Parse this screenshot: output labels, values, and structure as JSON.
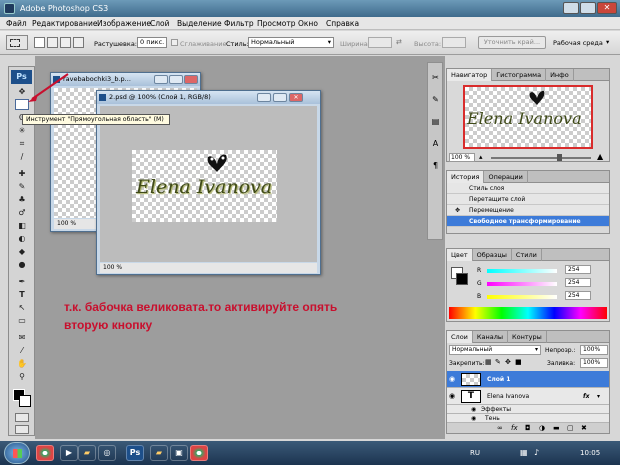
{
  "app": {
    "title": "Adobe Photoshop CS3",
    "ps_logo": "Ps"
  },
  "menu": [
    "Файл",
    "Редактирование",
    "Изображение",
    "Слой",
    "Выделение",
    "Фильтр",
    "Просмотр",
    "Окно",
    "Справка"
  ],
  "options": {
    "feather_label": "Растушевка:",
    "feather_value": "0 пикс.",
    "antialias_label": "Сглаживание",
    "style_label": "Стиль:",
    "style_value": "Нормальный",
    "width_label": "Ширина:",
    "height_label": "Высота:",
    "refine_button": "Уточнить край...",
    "workspace_label": "Рабочая среда"
  },
  "doc1": {
    "title": "ravebabochki3_b.p...",
    "zoom": "100 %"
  },
  "doc2": {
    "title": "2.psd @ 100% (Слой 1, RGB/8)",
    "zoom": "100 %",
    "artwork_text": "Elena Ivanova"
  },
  "tooltip": "Инструмент \"Прямоугольная область\" (M)",
  "annotation": "т.к. бабочка великовата.то активируйте опять вторую кнопку",
  "navigator": {
    "tabs": [
      "Навигатор",
      "Гистограмма",
      "Инфо"
    ],
    "zoom": "100 %",
    "artwork_text": "Elena Ivanova"
  },
  "history": {
    "tabs": [
      "История",
      "Операции"
    ],
    "items": [
      "Стиль слоя",
      "Перетащите слой",
      "Перемещение",
      "Свободное трансформирование"
    ],
    "selected_index": 3
  },
  "color": {
    "tabs": [
      "Цвет",
      "Образцы",
      "Стили"
    ],
    "channels": [
      {
        "name": "R",
        "value": "254"
      },
      {
        "name": "G",
        "value": "254"
      },
      {
        "name": "B",
        "value": "254"
      }
    ]
  },
  "layers": {
    "tabs": [
      "Слои",
      "Каналы",
      "Контуры"
    ],
    "blend_mode": "Нормальный",
    "opacity_label": "Непрозр.:",
    "opacity_value": "100%",
    "lock_label": "Закрепить:",
    "fill_label": "Заливка:",
    "fill_value": "100%",
    "rows": [
      {
        "name": "Слой 1"
      },
      {
        "name": "Elena Ivanova"
      },
      {
        "name": "Эффекты"
      },
      {
        "name": "Тень"
      }
    ]
  },
  "taskbar": {
    "language": "RU",
    "clock": "10:05"
  },
  "colors": {
    "selection_blue": "#3d7bd9",
    "annotation_red": "#c8102e",
    "navigator_frame": "#d92c2c"
  }
}
